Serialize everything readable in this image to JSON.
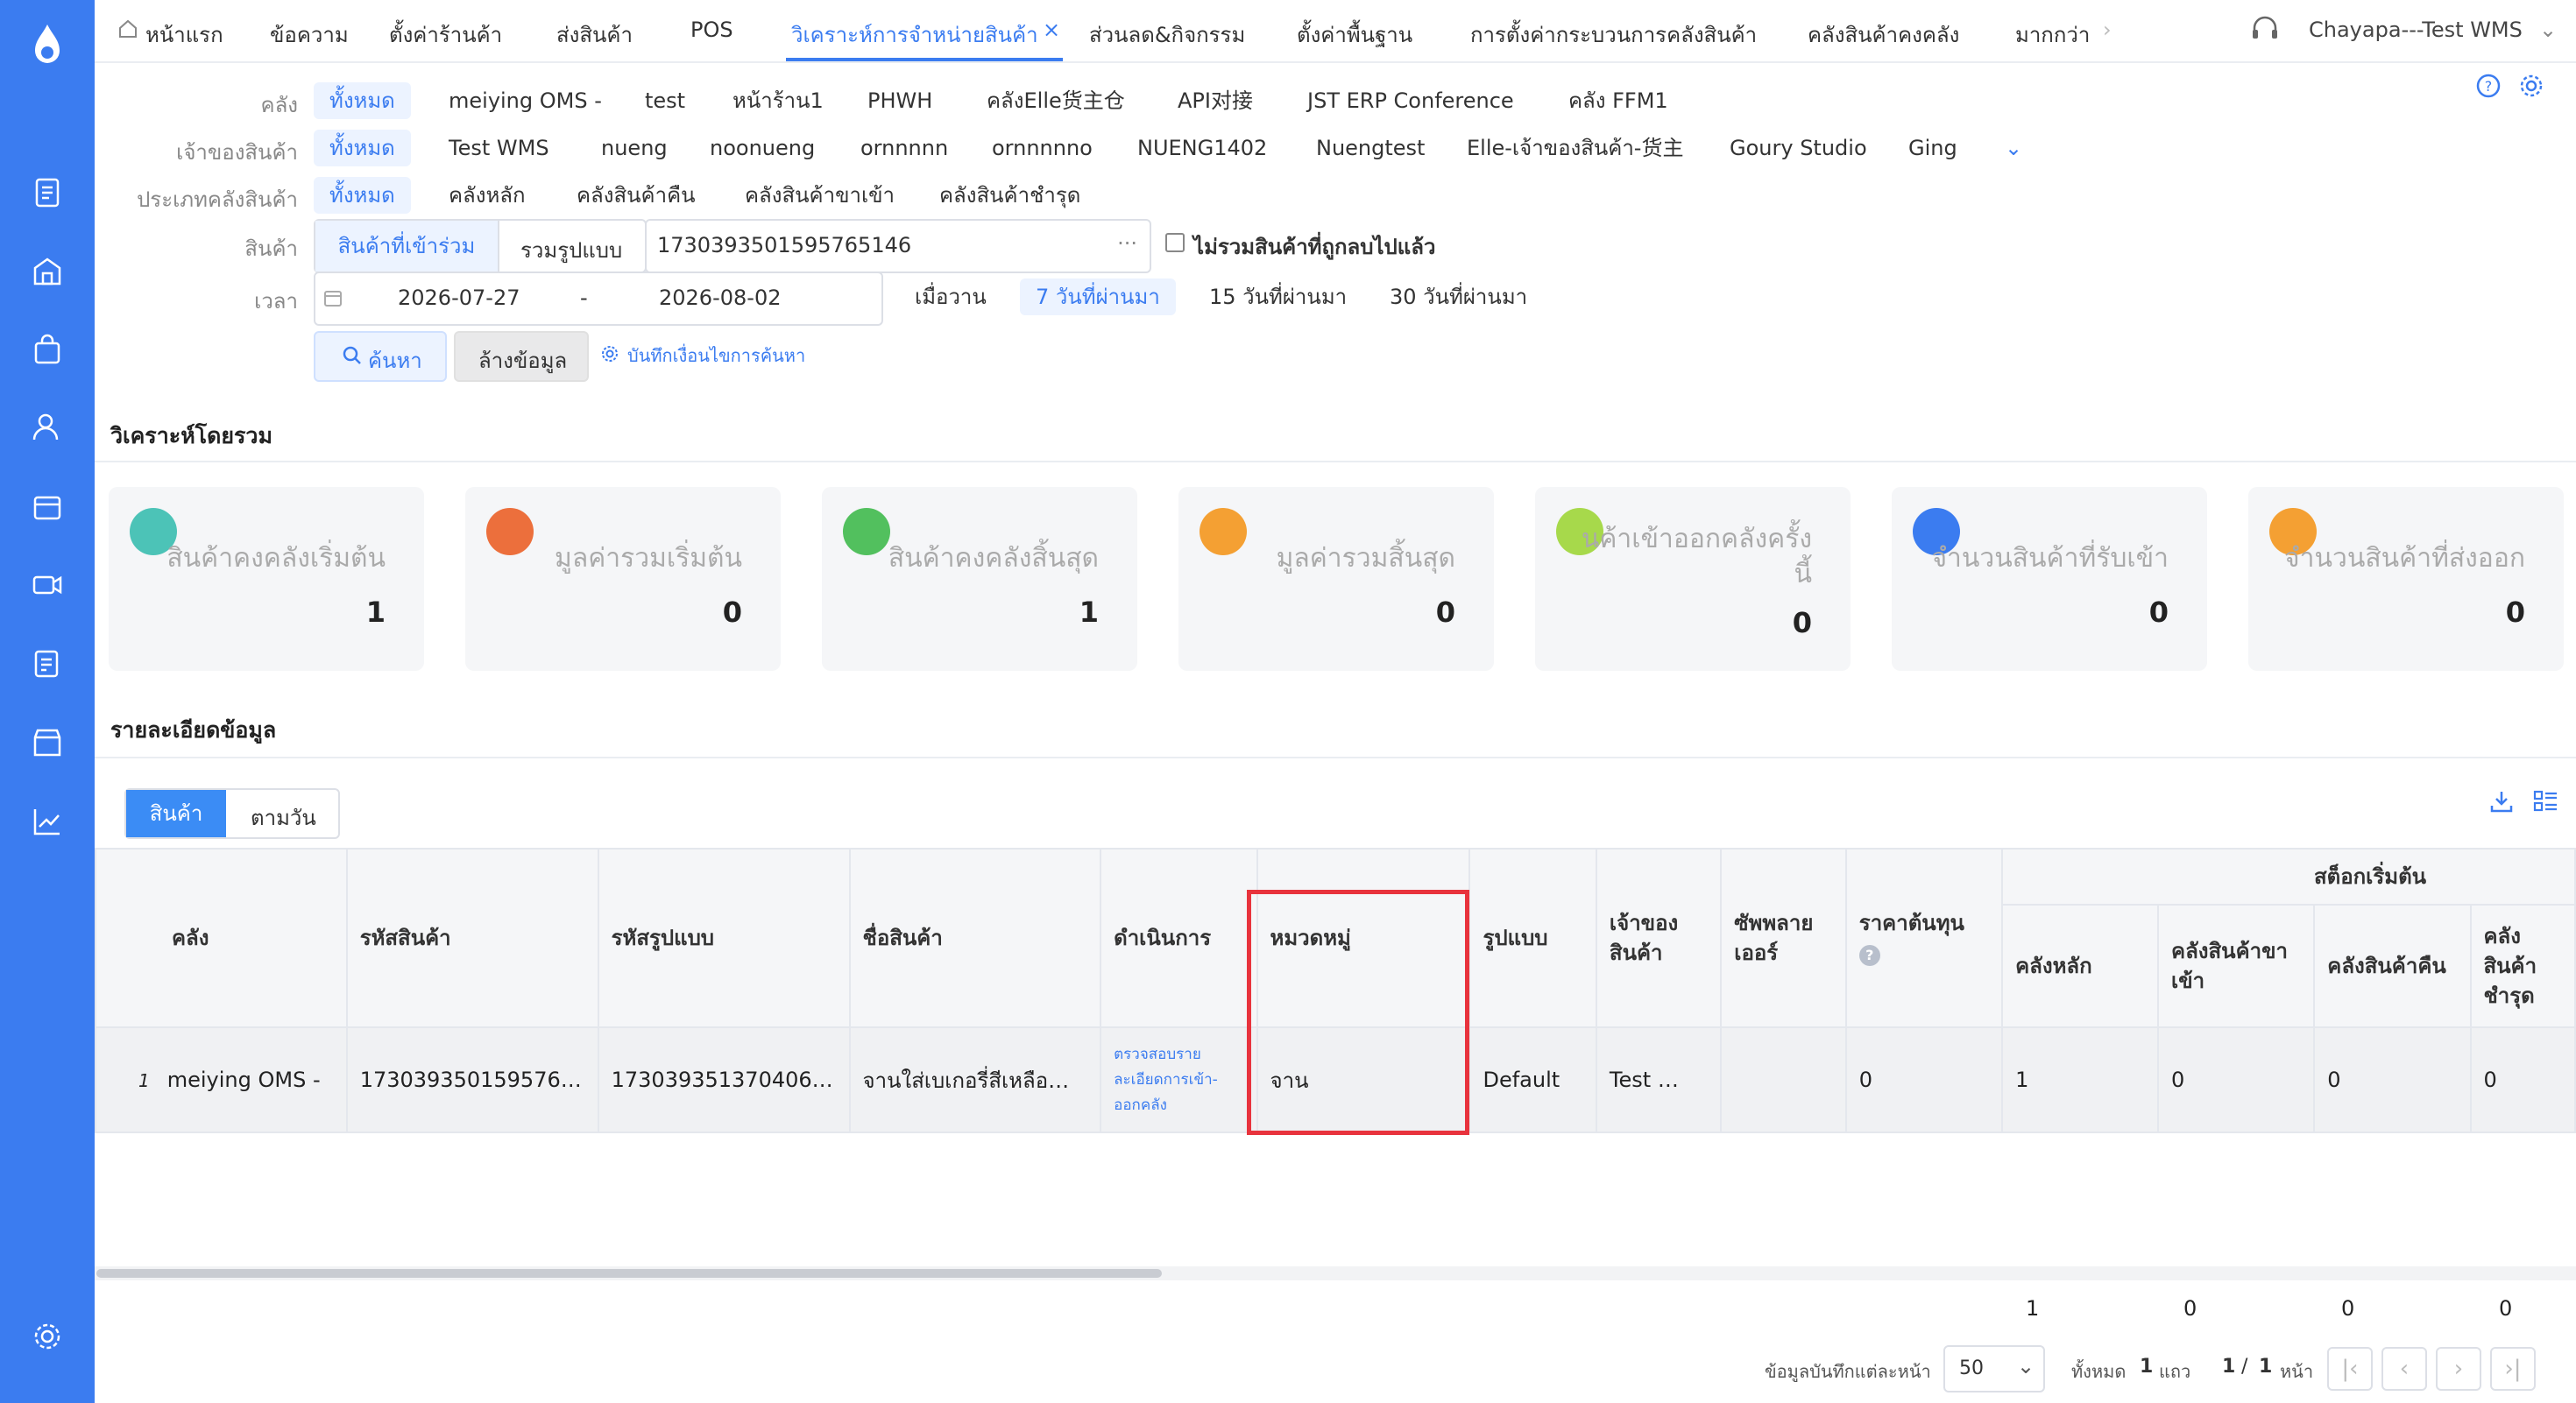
{
  "nav_tabs": [
    "หน้าแรก",
    "ข้อความ",
    "ตั้งค่าร้านค้า",
    "ส่งสินค้า",
    "POS",
    "วิเคราะห์การจำหน่ายสินค้า",
    "ส่วนลด&กิจกรรม",
    "ตั้งค่าพื้นฐาน",
    "การตั้งค่ากระบวนการคลังสินค้า",
    "คลังสินค้าคงคลัง",
    "มากกว่า"
  ],
  "user": {
    "name": "Chayapa---Test WMS"
  },
  "filters": {
    "warehouse": {
      "label": "คลัง",
      "options": [
        "ทั้งหมด",
        "meiying OMS -",
        "test",
        "หน้าร้าน1",
        "PHWH",
        "คลังElle货主仓",
        "API对接",
        "JST ERP Conference",
        "คลัง FFM1"
      ]
    },
    "owner": {
      "label": "เจ้าของสินค้า",
      "options": [
        "ทั้งหมด",
        "Test WMS",
        "nueng",
        "noonueng",
        "ornnnnn",
        "ornnnnno",
        "NUENG1402",
        "Nuengtest",
        "Elle-เจ้าของสินค้า-货主",
        "Goury Studio",
        "Ging"
      ]
    },
    "wh_type": {
      "label": "ประเภทคลังสินค้า",
      "options": [
        "ทั้งหมด",
        "คลังหลัก",
        "คลังสินค้าคืน",
        "คลังสินค้าขาเข้า",
        "คลังสินค้าชำรุด"
      ]
    },
    "product": {
      "label": "สินค้า",
      "seg1": "สินค้าที่เข้าร่วม",
      "seg2": "รวมรูปแบบ",
      "value": "1730393501595765146",
      "more": "···",
      "exclude_label": "ไม่รวมสินค้าที่ถูกลบไปแล้ว"
    },
    "time": {
      "label": "เวลา",
      "start": "2026-07-27",
      "sep": "-",
      "end": "2026-08-02",
      "quick": [
        "เมื่อวาน",
        "7 วันที่ผ่านมา",
        "15 วันที่ผ่านมา",
        "30 วันที่ผ่านมา"
      ]
    },
    "search_label": "ค้นหา",
    "clear_label": "ล้างข้อมูล",
    "save_label": "บันทึกเงื่อนไขการค้นหา"
  },
  "overview": {
    "title": "วิเคราะห์โดยรวม",
    "cards": [
      {
        "title": "สินค้าคงคลังเริ่มต้น",
        "value": "1",
        "color": "#4cc3b7"
      },
      {
        "title": "มูลค่ารวมเริ่มต้น",
        "value": "0",
        "color": "#ec6f3c"
      },
      {
        "title": "สินค้าคงคลังสิ้นสุด",
        "value": "1",
        "color": "#52c05e"
      },
      {
        "title": "มูลค่ารวมสิ้นสุด",
        "value": "0",
        "color": "#f4a033"
      },
      {
        "title": "นค้าเข้าออกคลังครั้ง",
        "title2": "นี้",
        "value": "0",
        "color": "#a7d94b"
      },
      {
        "title": "จำนวนสินค้าที่รับเข้า",
        "value": "0",
        "color": "#3b7cf0"
      },
      {
        "title": "จำนวนสินค้าที่ส่งออก",
        "value": "0",
        "color": "#f4a033"
      }
    ]
  },
  "detail": {
    "title": "รายละเอียดข้อมูล",
    "tabs": [
      "สินค้า",
      "ตามวัน"
    ],
    "group_header": "สต็อกเริ่มต้น",
    "columns": [
      "คลัง",
      "รหัสสินค้า",
      "รหัสรูปแบบ",
      "ชื่อสินค้า",
      "ดำเนินการ",
      "หมวดหมู่",
      "รูปแบบ",
      "เจ้าของสินค้า",
      "ซัพพลายเออร์",
      "ราคาต้นทุน",
      "คลังหลัก",
      "คลังสินค้าขาเข้า",
      "คลังสินค้าคืน",
      "คลังสินค้าชำรุด"
    ],
    "rows": [
      {
        "idx": "1",
        "warehouse": "meiying OMS -",
        "sku": "173039350159576…",
        "variant": "173039351370406…",
        "name": "จานใส่เบเกอรี่สีเหลือ…",
        "action": "ตรวจสอบรายละเอียดการเข้า-ออกคลัง",
        "category": "จาน",
        "style": "Default",
        "owner": "Test …",
        "supplier": "",
        "cost": "0",
        "main": "1",
        "inbound": "0",
        "returns": "0",
        "damaged": "0"
      }
    ],
    "totals": [
      "1",
      "0",
      "0",
      "0"
    ]
  },
  "pagination": {
    "per_page_label": "ข้อมูลบันทึกแต่ละหน้า",
    "per_page": "50",
    "total_prefix": "ทั้งหมด",
    "total": "1",
    "total_suffix": "แถว",
    "page": "1",
    "page_sep": "/",
    "pages": "1",
    "page_suffix": "หน้า"
  }
}
